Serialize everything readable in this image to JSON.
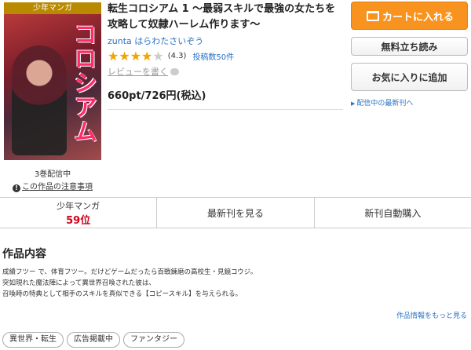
{
  "product": {
    "genre_badge": "少年マンガ",
    "cover_art_title": "コロシアム",
    "availability": "3巻配信中",
    "caution_link": "この作品の注意事項",
    "title": "転生コロシアム 1 ～最弱スキルで最強の女たちを攻略して奴隷ハーレム作ります～",
    "authors": "zunta はらわたさいぞう",
    "rating": {
      "value": 4.3,
      "max": 5,
      "display": "(4.3)",
      "review_count": "投稿数50件"
    },
    "review_link": "レビューを書く",
    "price": "660pt/726円(税込)"
  },
  "actions": {
    "cart": "カートに入れる",
    "trial": "無料立ち読み",
    "favorite": "お気に入りに追加",
    "latest_notify": "配信中の最新刊へ"
  },
  "stats_bar": {
    "rank_label": "少年マンガ",
    "rank_value": "59位",
    "latest_button": "最新刊を見る",
    "auto_buy_button": "新刊自動購入"
  },
  "contents": {
    "section_title": "作品内容",
    "lines": [
      "成績フツー で、体育フツー。だけどゲームだったら百戦錬磨の高校生・見鏡コウジ。",
      "突如現れた魔法陣によって異世界召喚された彼は、",
      "召喚時の特典として相手のスキルを真似できる【コピースキル】を与えられる。"
    ],
    "more_link": "作品情報をもっと見る"
  },
  "tags": [
    "異世界・転生",
    "広告掲載中",
    "ファンタジー"
  ],
  "colors": {
    "cart": "#f7931e",
    "badge": "#b98a00",
    "link": "#2a73c5",
    "rank": "#d0021b"
  }
}
